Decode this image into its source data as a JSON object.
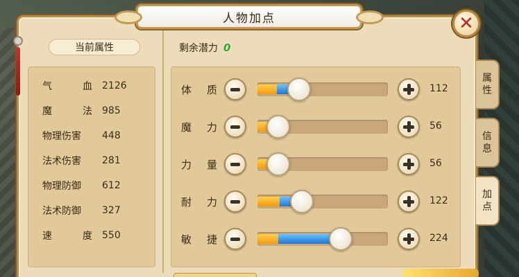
{
  "window": {
    "title": "人物加点",
    "close_symbol": "✕"
  },
  "current_stats": {
    "header": "当前属性",
    "rows": [
      {
        "name_a": "气",
        "name_b": "血",
        "value": "2126"
      },
      {
        "name_a": "魔",
        "name_b": "法",
        "value": "985"
      },
      {
        "name": "物理伤害",
        "value": "448"
      },
      {
        "name": "法术伤害",
        "value": "281"
      },
      {
        "name": "物理防御",
        "value": "612"
      },
      {
        "name": "法术防御",
        "value": "327"
      },
      {
        "name_a": "速",
        "name_b": "度",
        "value": "550"
      }
    ]
  },
  "remaining": {
    "label": "剩余潜力",
    "value": "0"
  },
  "attributes": [
    {
      "char_a": "体",
      "char_b": "质",
      "value": "112",
      "fill": 0.15,
      "knob": 0.32
    },
    {
      "char_a": "魔",
      "char_b": "力",
      "value": "56",
      "fill": 0.13,
      "knob": 0.16
    },
    {
      "char_a": "力",
      "char_b": "量",
      "value": "56",
      "fill": 0.13,
      "knob": 0.16
    },
    {
      "char_a": "耐",
      "char_b": "力",
      "value": "122",
      "fill": 0.17,
      "knob": 0.34
    },
    {
      "char_a": "敏",
      "char_b": "捷",
      "value": "224",
      "fill": 0.16,
      "knob": 0.64
    }
  ],
  "tabs": [
    {
      "label": "属性",
      "active": false
    },
    {
      "label": "信息",
      "active": false
    },
    {
      "label": "加点",
      "active": true
    }
  ],
  "colors": {
    "panel_bg": "#ecdcba",
    "box_bg": "#e1c99a",
    "fill_orange": "#f29a10",
    "fill_blue": "#1d77d8",
    "remain_green": "#2da72d",
    "close_red": "#c8271c"
  },
  "icons": {
    "close": "close-icon",
    "minus": "minus-icon",
    "plus": "plus-icon"
  }
}
